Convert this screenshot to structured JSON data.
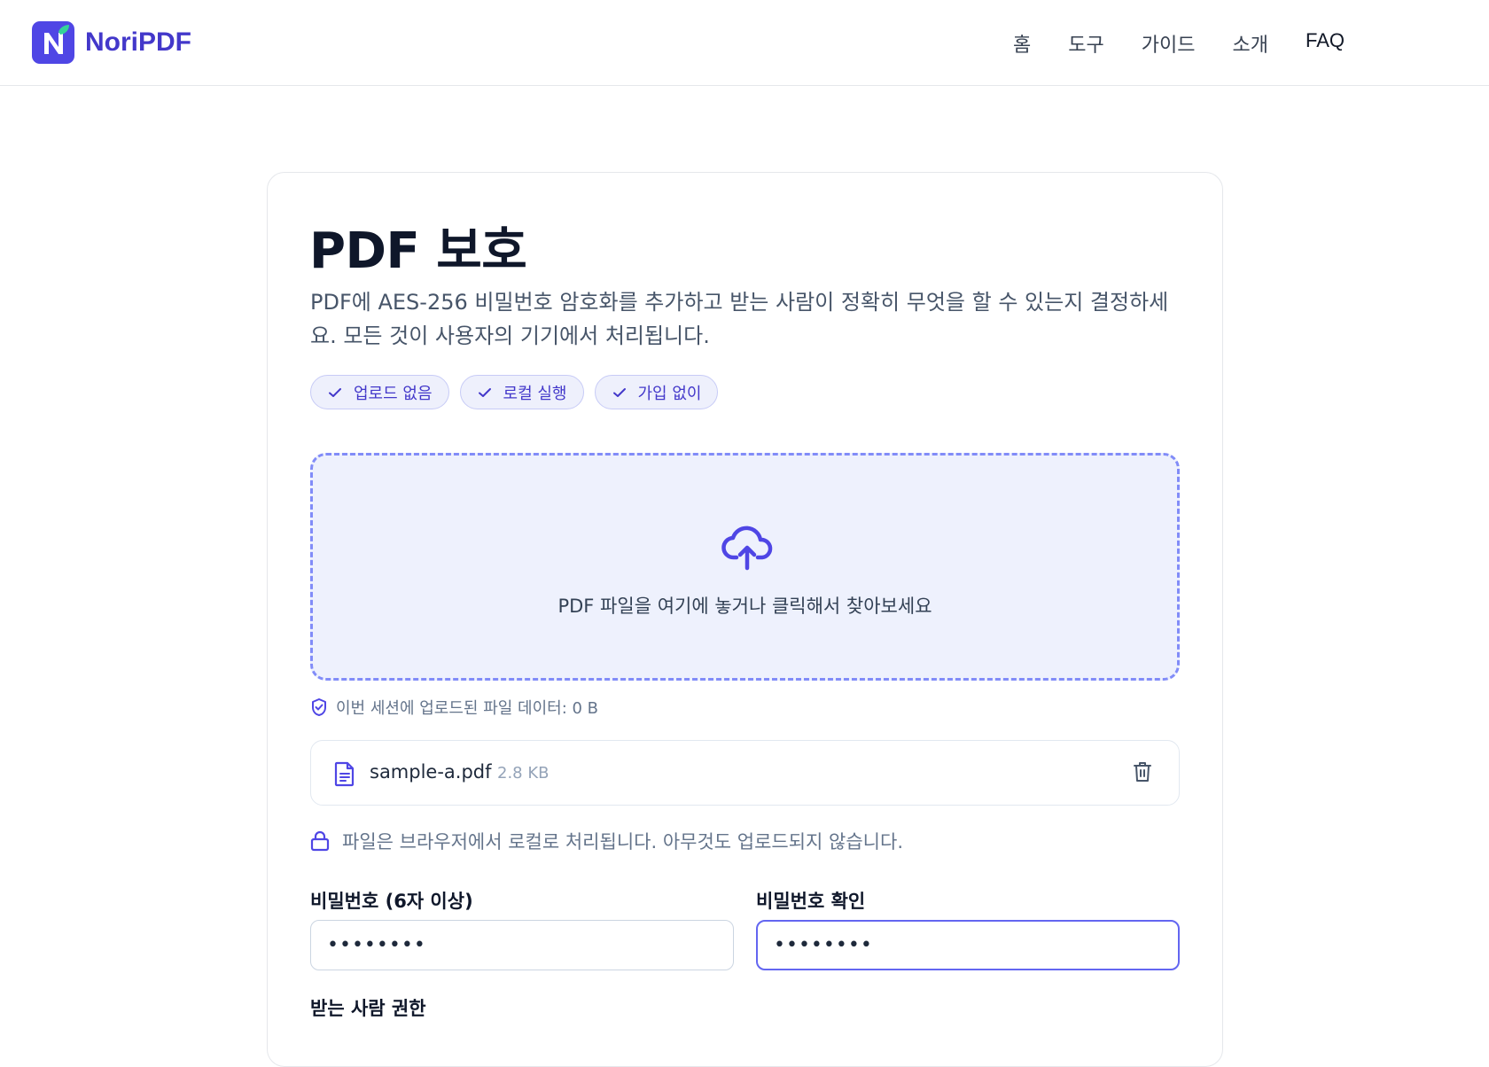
{
  "header": {
    "brand": "NoriPDF",
    "nav": [
      "홈",
      "도구",
      "가이드",
      "소개",
      "FAQ"
    ]
  },
  "main": {
    "title": "PDF 보호",
    "description": "PDF에 AES-256 비밀번호 암호화를 추가하고 받는 사람이 정확히 무엇을 할 수 있는지 결정하세요. 모든 것이 사용자의 기기에서 처리됩니다.",
    "chips": [
      "업로드 없음",
      "로컬 실행",
      "가입 없이"
    ],
    "dropzone_text": "PDF 파일을 여기에 놓거나 클릭해서 찾아보세요",
    "session_note": "이번 세션에 업로드된 파일 데이터: 0 B",
    "file": {
      "name": "sample-a.pdf",
      "size": "2.8 KB"
    },
    "local_note": "파일은 브라우저에서 로컬로 처리됩니다. 아무것도 업로드되지 않습니다.",
    "password_label": "비밀번호 (6자 이상)",
    "password_value": "••••••••",
    "confirm_label": "비밀번호 확인",
    "confirm_value": "••••••••",
    "permissions_label": "받는 사람 권한"
  },
  "colors": {
    "accent": "#4f46e5",
    "chip_bg": "#eef0fc",
    "dropzone_border": "#818cf8"
  },
  "icons": {
    "logo": "n-leaf-logo",
    "chip": "check-icon",
    "upload": "cloud-upload-icon",
    "session": "shield-check-icon",
    "file": "file-text-icon",
    "delete": "trash-icon",
    "lock": "lock-icon"
  }
}
